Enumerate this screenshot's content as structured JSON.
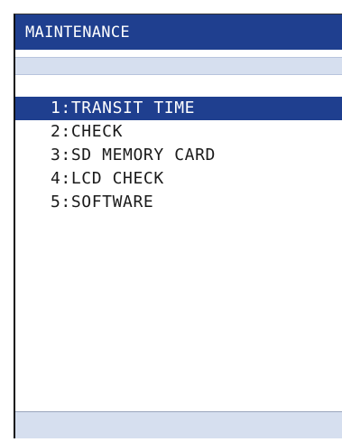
{
  "header": {
    "title": "MAINTENANCE"
  },
  "menu": {
    "selected_index": 0,
    "items": [
      {
        "label": "1:TRANSIT TIME"
      },
      {
        "label": "2:CHECK"
      },
      {
        "label": "3:SD MEMORY CARD"
      },
      {
        "label": "4:LCD CHECK"
      },
      {
        "label": "5:SOFTWARE"
      }
    ]
  },
  "colors": {
    "accent": "#1f3f8f",
    "bar": "#d6dfef",
    "text": "#1a1a1a"
  }
}
